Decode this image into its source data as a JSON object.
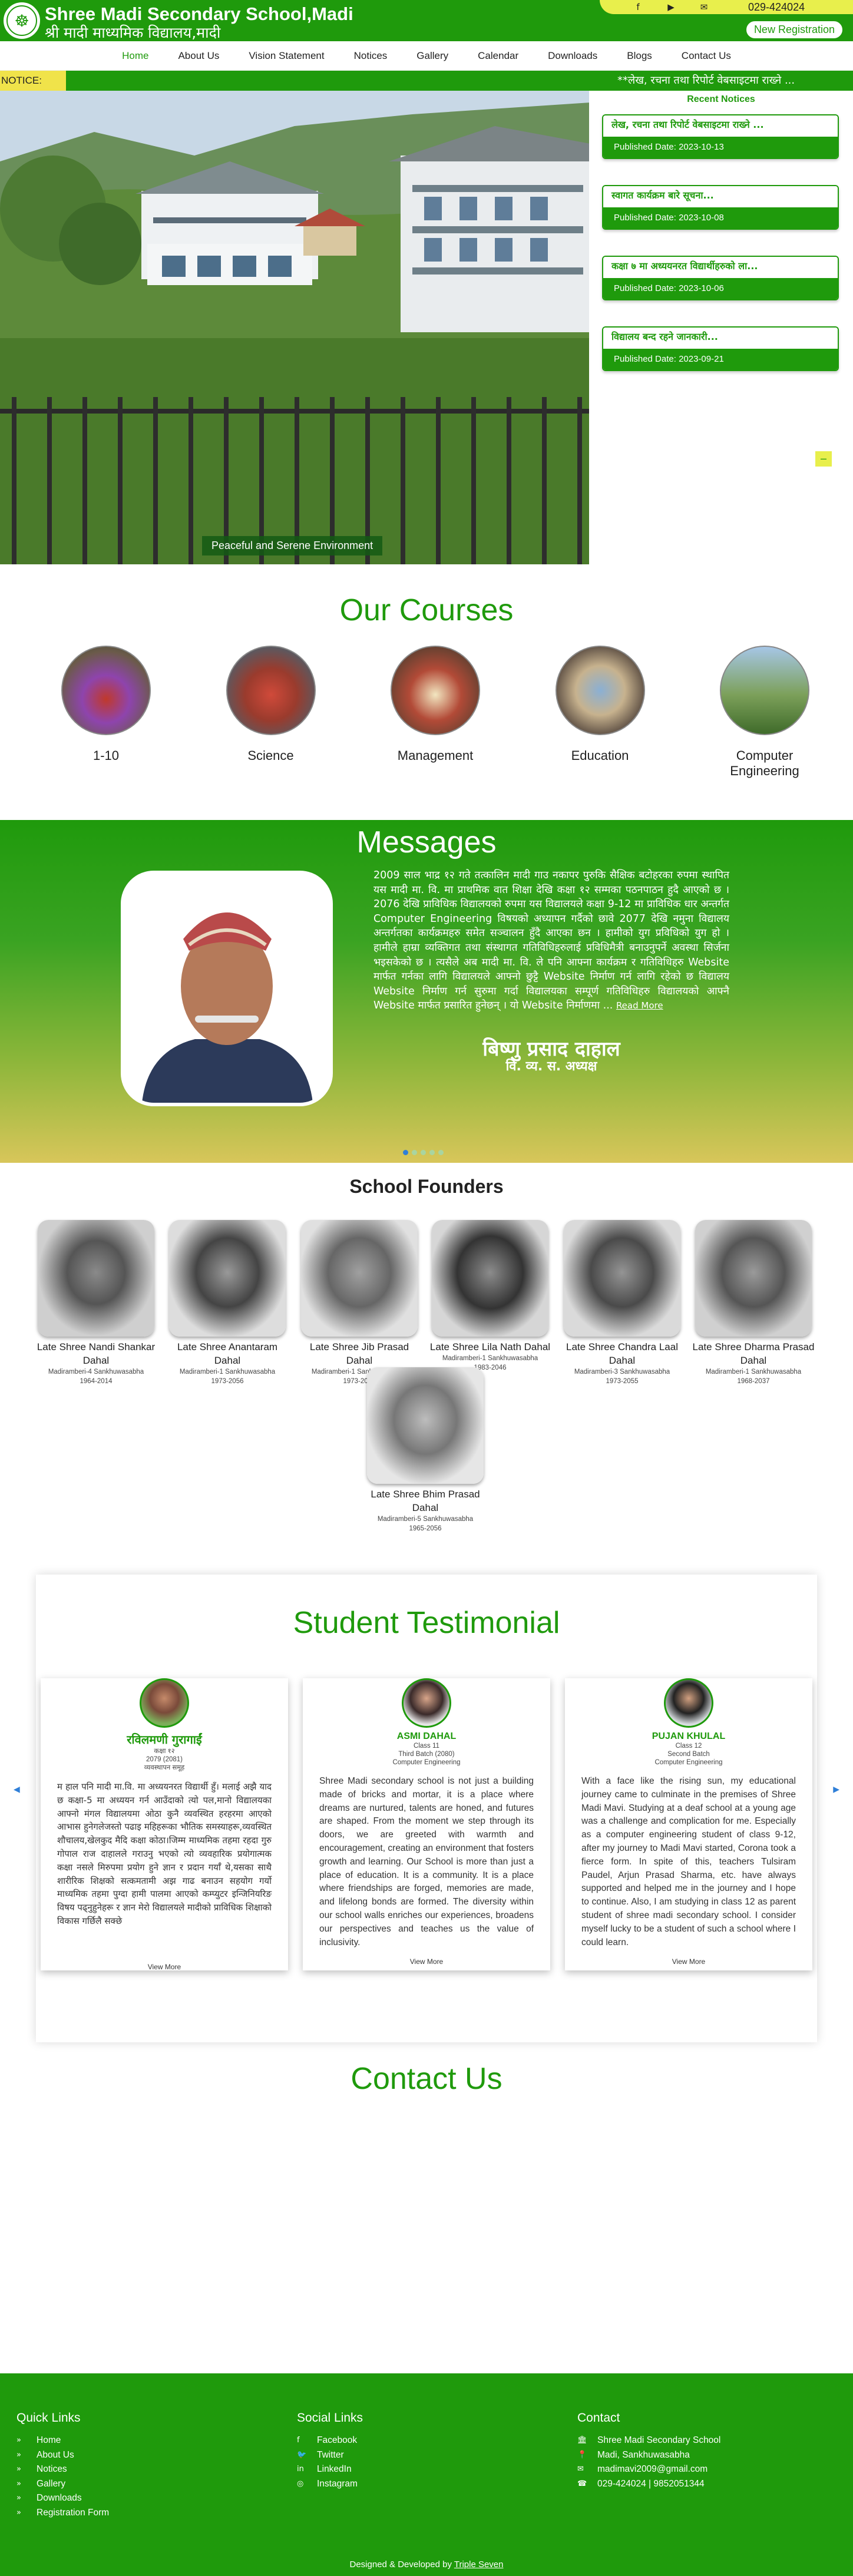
{
  "header": {
    "site_name": "Shree Madi Secondary School,Madi",
    "site_name_np": "श्री मादी माध्यमिक विद्यालय,मादी",
    "phone": "029-424024",
    "new_registration": "New Registration",
    "social_icons": [
      "facebook-icon",
      "youtube-icon",
      "email-icon"
    ]
  },
  "nav": {
    "items": [
      "Home",
      "About Us",
      "Vision Statement",
      "Notices",
      "Gallery",
      "Calendar",
      "Downloads",
      "Blogs",
      "Contact Us"
    ],
    "active": "Home"
  },
  "notice_bar": {
    "label": "NOTICE:",
    "text": "**लेख, रचना तथा रिपोर्ट वेबसाइटमा राख्ने ..."
  },
  "hero": {
    "caption": "Peaceful and Serene Environment"
  },
  "recent_notices": {
    "title": "Recent Notices",
    "items": [
      {
        "title": "लेख, रचना तथा रिपोर्ट वेबसाइटमा राख्ने ...",
        "date": "Published Date: 2023-10-13"
      },
      {
        "title": "स्वागत कार्यक्रम बारे सूचना...",
        "date": "Published Date: 2023-10-08"
      },
      {
        "title": "कक्षा ७ मा अध्ययनरत विद्यार्थीहरुको ला...",
        "date": "Published Date: 2023-10-06"
      },
      {
        "title": "विद्यालय बन्द रहने जानकारी...",
        "date": "Published Date: 2023-09-21"
      }
    ]
  },
  "courses": {
    "title": "Our Courses",
    "items": [
      "1-10",
      "Science",
      "Management",
      "Education",
      "Computer Engineering"
    ]
  },
  "messages": {
    "title": "Messages",
    "body": "2009 साल भाद्र १२ गते तत्कालिन मादी गाउ नकापर पुरुकि सैक्षिक बटोहरका रुपमा स्थापित यस मादी मा. वि. मा प्राथमिक वात शिक्षा देखि कक्षा १२ सम्मका पठनपाठन हुदै आएको छ । 2076 देखि प्राविधिक विद्यालयको रुपमा यस विद्यालयले कक्षा 9-12 मा प्राविधिक धार अन्तर्गत Computer Engineering विषयको अध्यापन गर्दैको छावे 2077 देखि नमुना विद्यालय अन्तर्गतका कार्यक्रमहरु समेत सञ्चालन हुँदै आएका छन । हामीको युग प्रविधिको युग हो । हामीले हाम्रा व्यक्तिगत तथा संस्थागत गतिविधिहरुलाई प्रविधिमैत्री बनाउनुपर्ने अवस्था सिर्जना भइसकेको छ । त्यसैले अब मादी मा. वि. ले पनि आफ्ना कार्यक्रम र गतिविधिहरु Website मार्फत गर्नका लागि विद्यालयले आफ्नो छुट्टै Website निर्माण गर्न लागि रहेको छ विद्यालय Website निर्माण गर्न सुरुमा गर्दा विद्यालयका सम्पूर्ण गतिविधिहरु विद्यालयको आफ्नै Website मार्फत प्रसारित हुनेछन् । यो Website निर्माणमा ...",
    "read_more": "Read More",
    "name": "बिष्णु प्रसाद दाहाल",
    "role": "वि. व्य. स. अध्यक्ष",
    "slides": 5,
    "active_slide": 1
  },
  "founders": {
    "title": "School Founders",
    "items": [
      {
        "name": "Late Shree Nandi Shankar Dahal",
        "address": "Madiramberi-4 Sankhuwasabha",
        "years": "1964-2014"
      },
      {
        "name": "Late Shree Anantaram Dahal",
        "address": "Madiramberi-1 Sankhuwasabha",
        "years": "1973-2056"
      },
      {
        "name": "Late Shree Jib Prasad Dahal",
        "address": "Madiramberi-1 Sankhuwasabha",
        "years": "1973-2066"
      },
      {
        "name": "Late Shree Lila Nath Dahal",
        "address": "Madiramberi-1 Sankhuwasabha",
        "years": "1983-2046"
      },
      {
        "name": "Late Shree Chandra Laal Dahal",
        "address": "Madiramberi-3 Sankhuwasabha",
        "years": "1973-2055"
      },
      {
        "name": "Late Shree Dharma Prasad Dahal",
        "address": "Madiramberi-1 Sankhuwasabha",
        "years": "1968-2037"
      },
      {
        "name": "Late Shree Bhim Prasad Dahal",
        "address": "Madiramberi-5 Sankhuwasabha",
        "years": "1965-2056"
      }
    ]
  },
  "testimonials": {
    "title": "Student Testimonial",
    "items": [
      {
        "name": "रविलमणी गुरागाईं",
        "class": "कक्षा १२",
        "batch": "2079 (2081)",
        "stream": "व्यवस्थापन समूह",
        "body": "म हाल पनि मादी मा.वि. मा अध्ययनरत विद्यार्थी हुँ। मलाई अझै याद छ कक्षा-5 मा अध्ययन गर्न आउँदाको त्यो पल,मानो विद्यालयका आफ्नो मंगल विद्यालयमा ओठा कुनै व्यवस्थित हरहरमा आएको आभास हुनेगलेजस्तो पढाइ महिहरूका भौतिक समस्याहरू,व्यवस्थित शौचालय,खेलकुद मैदि कक्षा कोठा।जिम्म माध्यमिक तहमा रहदा गुरु गोपाल राज दाहालले गराउनु भएको त्यो व्यवहारिक प्रयोगात्मक कक्षा नसले मिरुपमा प्रयोग हुने ज्ञान र प्रदान गर्याँ थे,यसका साथै शारीरिक शिक्षको सत्कमतामी अझ गाढ बनाउन सहयोग गर्यो माध्यमिक तहमा पुग्दा हामी पालमा आएको कम्प्युटर इन्जिनियरिङ विषय पढ्नुहुनेहरू र ज्ञान मेरो विद्यालयले मादीको प्राविधिक शिक्षाको विकास गर्छिलै सक्छे",
        "more": "View More"
      },
      {
        "name": "ASMI DAHAL",
        "class": "Class 11",
        "batch": "Third Batch (2080)",
        "stream": "Computer Engineering",
        "body": "Shree Madi secondary school is not just a building made of bricks and mortar, it is a place where dreams are nurtured, talents are honed, and futures are shaped. From the moment we step through its doors, we are greeted with warmth and encouragement, creating an environment that fosters growth and learning. Our School is more than just a place of education. It is a community. It is a place where friendships are forged, memories are made, and lifelong bonds are formed. The diversity within our school walls enriches our experiences, broadens our perspectives and teaches us the value of inclusivity.",
        "more": "View More"
      },
      {
        "name": "PUJAN KHULAL",
        "class": "Class 12",
        "batch": "Second Batch",
        "stream": "Computer Engineering",
        "body": "With a face like the rising sun, my educational journey came to culminate in the premises of Shree Madi Mavi. Studying at a deaf school at a young age was a challenge and complication for me. Especially as a computer engineering student of class 9-12, after my journey to Madi Mavi started, Corona took a fierce form. In spite of this, teachers Tulsiram Paudel, Arjun Prasad Sharma, etc. have always supported and helped me in the journey and I hope to continue. Also, I am studying in class 12 as parent student of shree madi secondary school. I consider myself lucky to be a student of such a school where I could learn.",
        "more": "View More"
      }
    ]
  },
  "contact": {
    "title": "Contact Us"
  },
  "footer": {
    "quick_links": {
      "title": "Quick Links",
      "items": [
        "Home",
        "About Us",
        "Notices",
        "Gallery",
        "Downloads",
        "Registration Form"
      ]
    },
    "social_links": {
      "title": "Social Links",
      "items": [
        {
          "label": "Facebook",
          "icon": "facebook-icon"
        },
        {
          "label": "Twitter",
          "icon": "twitter-icon"
        },
        {
          "label": "LinkedIn",
          "icon": "linkedin-icon"
        },
        {
          "label": "Instagram",
          "icon": "instagram-icon"
        }
      ]
    },
    "contact": {
      "title": "Contact",
      "items": [
        {
          "label": "Shree Madi Secondary School",
          "icon": "school-icon"
        },
        {
          "label": "Madi, Sankhuwasabha",
          "icon": "location-icon"
        },
        {
          "label": "madimavi2009@gmail.com",
          "icon": "email-icon"
        },
        {
          "label": "029-424024 | 9852051344",
          "icon": "phone-icon"
        }
      ]
    },
    "credit_prefix": "Designed & Developed by ",
    "credit_link": "Triple Seven"
  },
  "colors": {
    "brand_green": "#1f9a0c",
    "accent_yellow": "#e8ef4c"
  }
}
